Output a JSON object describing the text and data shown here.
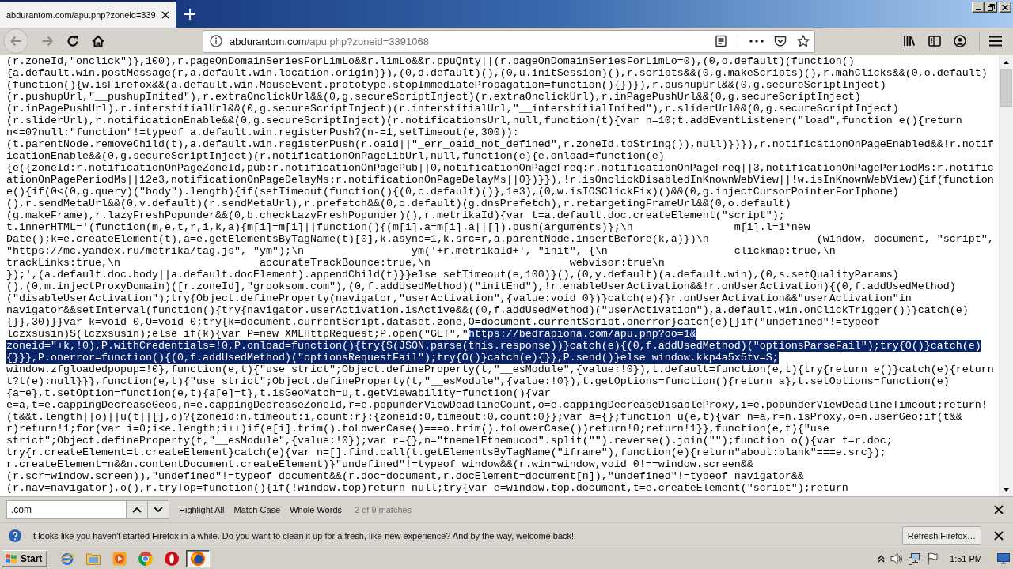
{
  "tab": {
    "title": "abdurantom.com/apu.php?zoneid=339"
  },
  "toolbar": {
    "url": {
      "host": "abdurantom.com",
      "path": "/apu.php?zoneid=3391068"
    }
  },
  "code_lines": [
    {
      "segments": [
        {
          "text": "(r.zoneId,\"onclick\")},100),r.pageOnDomainSeriesForLimLo&&r.limLo&&r.ppuQnty||(r.pageOnDomainSeriesForLimLo=0),(0,o.default)(function()",
          "selected": false
        }
      ]
    },
    {
      "segments": [
        {
          "text": "{a.default.win.postMessage(r,a.default.win.location.origin)}),(0,d.default)(),(0,u.initSession)(),r.scripts&&(0,g.makeScripts)(),r.mahClicks&&(0,o.default)",
          "selected": false
        }
      ]
    },
    {
      "segments": [
        {
          "text": "(function(){w.isFirefox&&(a.default.win.MouseEvent.prototype.stopImmediatePropagation=function(){})}),r.pushupUrl&&(0,g.secureScriptInject)",
          "selected": false
        }
      ]
    },
    {
      "segments": [
        {
          "text": "(r.pushupUrl,\"__pushupInited\"),r.extraOnclickUrl&&(0,g.secureScriptInject)(r.extraOnclickUrl),r.inPagePushUrl&&(0,g.secureScriptInject)",
          "selected": false
        }
      ]
    },
    {
      "segments": [
        {
          "text": "(r.inPagePushUrl),r.interstitialUrl&&(0,g.secureScriptInject)(r.interstitialUrl,\"__interstitialInited\"),r.sliderUrl&&(0,g.secureScriptInject)",
          "selected": false
        }
      ]
    },
    {
      "segments": [
        {
          "text": "(r.sliderUrl),r.notificationEnable&&(0,g.secureScriptInject)(r.notificationsUrl,null,function(t){var n=10;t.addEventListener(\"load\",function e(){return",
          "selected": false
        }
      ]
    },
    {
      "segments": [
        {
          "text": "n<=0?null:\"function\"!=typeof a.default.win.registerPush?(n-=1,setTimeout(e,300)):",
          "selected": false
        }
      ]
    },
    {
      "segments": [
        {
          "text": "(t.parentNode.removeChild(t),a.default.win.registerPush(r.oaid||\"_err_oaid_not_defined\",r.zoneId.toString()),null)})}),r.notificationOnPageEnabled&&!r.notif",
          "selected": false
        }
      ]
    },
    {
      "segments": [
        {
          "text": "icationEnable&&(0,g.secureScriptInject)(r.notificationOnPageLibUrl,null,function(e){e.onload=function(e)",
          "selected": false
        }
      ]
    },
    {
      "segments": [
        {
          "text": "{e({zoneId:r.notificationOnPageZoneId,pub:r.notificationOnPagePub||0,notificationOnPageFreq:r.notificationOnPageFreq||3,notificationOnPagePeriodMs:r.notific",
          "selected": false
        }
      ]
    },
    {
      "segments": [
        {
          "text": "ationOnPagePeriodMs||12e3,notificationOnPageDelayMs:r.notificationOnPageDelayMs||0})}}),!r.isOnclickDisabledInKnownWebView||!w.isInKnownWebView){if(function",
          "selected": false
        }
      ]
    },
    {
      "segments": [
        {
          "text": "e(){if(0<(0,g.query)(\"body\").length){if(setTimeout(function(){(0,c.default)()},1e3),(0,w.isIOSClickFix)()&&(0,g.injectCursorPointerForIphone)",
          "selected": false
        }
      ]
    },
    {
      "segments": [
        {
          "text": "(),r.sendMetaUrl&&(0,v.default)(r.sendMetaUrl),r.prefetch&&(0,o.default)(g.dnsPrefetch),r.retargetingFrameUrl&&(0,o.default)",
          "selected": false
        }
      ]
    },
    {
      "segments": [
        {
          "text": "(g.makeFrame),r.lazyFreshPopunder&&(0,b.checkLazyFreshPopunder)(),r.metrikaId){var t=a.default.doc.createElement(\"script\");",
          "selected": false
        }
      ]
    },
    {
      "segments": [
        {
          "text": "t.innerHTML='(function(m,e,t,r,i,k,a){m[i]=m[i]||function(){(m[i].a=m[i].a||[]).push(arguments)};\\n                m[i].l=1*new",
          "selected": false
        }
      ]
    },
    {
      "segments": [
        {
          "text": "Date();k=e.createElement(t),a=e.getElementsByTagName(t)[0],k.async=1,k.src=r,a.parentNode.insertBefore(k,a)})\\n                 (window, document, \"script\",",
          "selected": false
        }
      ]
    },
    {
      "segments": [
        {
          "text": "\"https://mc.yandex.ru/metrika/tag.js\", \"ym\");\\n                 ym('+r.metrikaId+', \"init\", {\\n                    clickmap:true,\\n",
          "selected": false
        }
      ]
    },
    {
      "segments": [
        {
          "text": "trackLinks:true,\\n                      accurateTrackBounce:true,\\n                      webvisor:true\\n",
          "selected": false
        }
      ]
    },
    {
      "segments": [
        {
          "text": "});',(a.default.doc.body||a.default.docElement).appendChild(t)}}else setTimeout(e,100)}(),(0,y.default)(a.default.win),(0,s.setQualityParams)",
          "selected": false
        }
      ]
    },
    {
      "segments": [
        {
          "text": "(),(0,m.injectProxyDomain)([r.zoneId],\"grooksom.com\"),(0,f.addUsedMethod)(\"initEnd\"),!r.enableUserActivation&&!r.onUserActivation){(0,f.addUsedMethod)",
          "selected": false
        }
      ]
    },
    {
      "segments": [
        {
          "text": "(\"disableUserActivation\");try{Object.defineProperty(navigator,\"userActivation\",{value:void 0})}catch(e){}r.onUserActivation&&\"userActivation\"in",
          "selected": false
        }
      ]
    },
    {
      "segments": [
        {
          "text": "navigator&&setInterval(function(){try{navigator.userActivation.isActive&&((0,f.addUsedMethod)(\"userActivation\"),a.default.win.onClickTrigger())}catch(e)",
          "selected": false
        }
      ]
    },
    {
      "segments": [
        {
          "text": "{}},30)}}var k=void 0,O=void 0;try{k=document.currentScript.dataset.zone,O=document.currentScript.onerror}catch(e){}if(\"undefined\"!=typeof",
          "selected": false
        }
      ]
    },
    {
      "segments": [
        {
          "text": "lczxsusin)S(lczxsusin);else if(k){var P=new XMLHttpRequest;P.open(\"GET\",\"",
          "selected": false
        },
        {
          "text": "https://bedrapiona.com/apu.php?oo=1&",
          "selected": true
        }
      ]
    },
    {
      "segments": [
        {
          "text": "zoneid=\"+k,!0),P.withCredentials=!0,P.onload=function(){try{S(JSON.parse(this.response))}catch(e){(0,f.addUsedMethod)(\"optionsParseFail\");try{O()}catch(e)",
          "selected": true
        }
      ]
    },
    {
      "segments": [
        {
          "text": "{}}},P.onerror=function(){(0,f.addUsedMethod)(\"optionsRequestFail\");try{O()}catch(e){}},P.send()}else window.kkp4a5x5tv=S;",
          "selected": true
        }
      ]
    },
    {
      "segments": [
        {
          "text": "window.zfgloadedpopup=!0},function(e,t){\"use strict\";Object.defineProperty(t,\"__esModule\",{value:!0}),t.default=function(e,t){try{return e()}catch(e){return",
          "selected": false
        }
      ]
    },
    {
      "segments": [
        {
          "text": "t?t(e):null}}},function(e,t){\"use strict\";Object.defineProperty(t,\"__esModule\",{value:!0}),t.getOptions=function(){return a},t.setOptions=function(e)",
          "selected": false
        }
      ]
    },
    {
      "segments": [
        {
          "text": "{a=e},t.setOption=function(e,t){a[e]=t},t.isGeoMatch=u,t.getViewability=function(){var",
          "selected": false
        }
      ]
    },
    {
      "segments": [
        {
          "text": "e=a,t=e.cappingDecreaseGeos,n=e.cappingDecreaseZoneId,r=e.popunderViewDeadlineCount,o=e.cappingDecreaseDisableProxy,i=e.popunderViewDeadlineTimeout;return!",
          "selected": false
        }
      ]
    },
    {
      "segments": [
        {
          "text": "(t&&t.length||o)||u(t||[],o)?{zoneid:n,timeout:i,count:r}:{zoneid:0,timeout:0,count:0}};var a={};function u(e,t){var n=a,r=n.isProxy,o=n.userGeo;if(t&&",
          "selected": false
        }
      ]
    },
    {
      "segments": [
        {
          "text": "r)return!1;for(var i=0;i<e.length;i++)if(e[i].trim().toLowerCase()===o.trim().toLowerCase())return!0;return!1}},function(e,t){\"use",
          "selected": false
        }
      ]
    },
    {
      "segments": [
        {
          "text": "strict\";Object.defineProperty(t,\"__esModule\",{value:!0});var r={},n=\"tnemelEtnemucod\".split(\"\").reverse().join(\"\");function o(){var t=r.doc;",
          "selected": false
        }
      ]
    },
    {
      "segments": [
        {
          "text": "try{r.createElement=t.createElement}catch(e){var n=[].find.call(t.getElementsByTagName(\"iframe\"),function(e){return\"about:blank\"===e.src});",
          "selected": false
        }
      ]
    },
    {
      "segments": [
        {
          "text": "r.createElement=n&&n.contentDocument.createElement)}\"undefined\"!=typeof window&&(r.win=window,void 0!==window.screen&&",
          "selected": false
        }
      ]
    },
    {
      "segments": [
        {
          "text": "(r.scr=window.screen)),\"undefined\"!=typeof document&&(r.doc=document,r.docElement=document[n]),\"undefined\"!=typeof navigator&&",
          "selected": false
        }
      ]
    },
    {
      "segments": [
        {
          "text": "(r.nav=navigator),o(),r.tryTop=function(){if(!window.top)return null;try{var e=window.top.document,t=e.createElement(\"script\");return",
          "selected": false
        }
      ]
    }
  ],
  "find_bar": {
    "value": ".com",
    "options": [
      "Highlight All",
      "Match Case",
      "Whole Words"
    ],
    "status": "2 of 9 matches"
  },
  "notification": {
    "text": "It looks like you haven't started Firefox in a while. Do you want to clean it up for a fresh, like-new experience? And by the way, welcome back!",
    "button": "Refresh Firefox…"
  },
  "taskbar": {
    "start": "Start",
    "clock": "1:51 PM",
    "apps": [
      {
        "kind": "ie",
        "active": false
      },
      {
        "kind": "folder",
        "active": false
      },
      {
        "kind": "media",
        "active": false
      },
      {
        "kind": "chrome",
        "active": false
      },
      {
        "kind": "opera",
        "active": false
      },
      {
        "kind": "firefox",
        "active": true
      }
    ]
  }
}
